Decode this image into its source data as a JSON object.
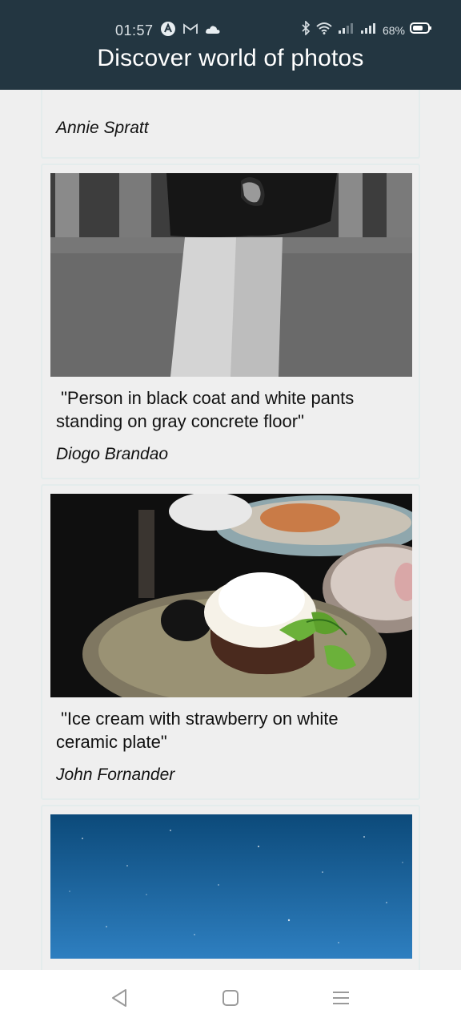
{
  "status_bar": {
    "time": "01:57",
    "battery_percent": "68%",
    "left_icons": [
      "app-a-icon",
      "gmail-icon",
      "cloud-icon"
    ],
    "right_icons": [
      "bluetooth-icon",
      "wifi-icon",
      "signal-1-icon",
      "signal-2-icon",
      "battery-icon"
    ]
  },
  "header": {
    "title": "Discover world of photos",
    "background": "#233641"
  },
  "feed": {
    "cards": [
      {
        "author": "Annie Spratt"
      },
      {
        "caption": " \"Person in black coat and white pants standing on gray concrete floor\"",
        "author": "Diogo Brandao",
        "image": "photo-person-black-coat"
      },
      {
        "caption": " \"Ice cream with strawberry on white ceramic plate\"",
        "author": "John Fornander",
        "image": "photo-ice-cream-plate"
      },
      {
        "image": "photo-starry-sky"
      }
    ]
  },
  "nav_bar": {
    "buttons": [
      "back-icon",
      "home-icon",
      "menu-icon"
    ]
  }
}
